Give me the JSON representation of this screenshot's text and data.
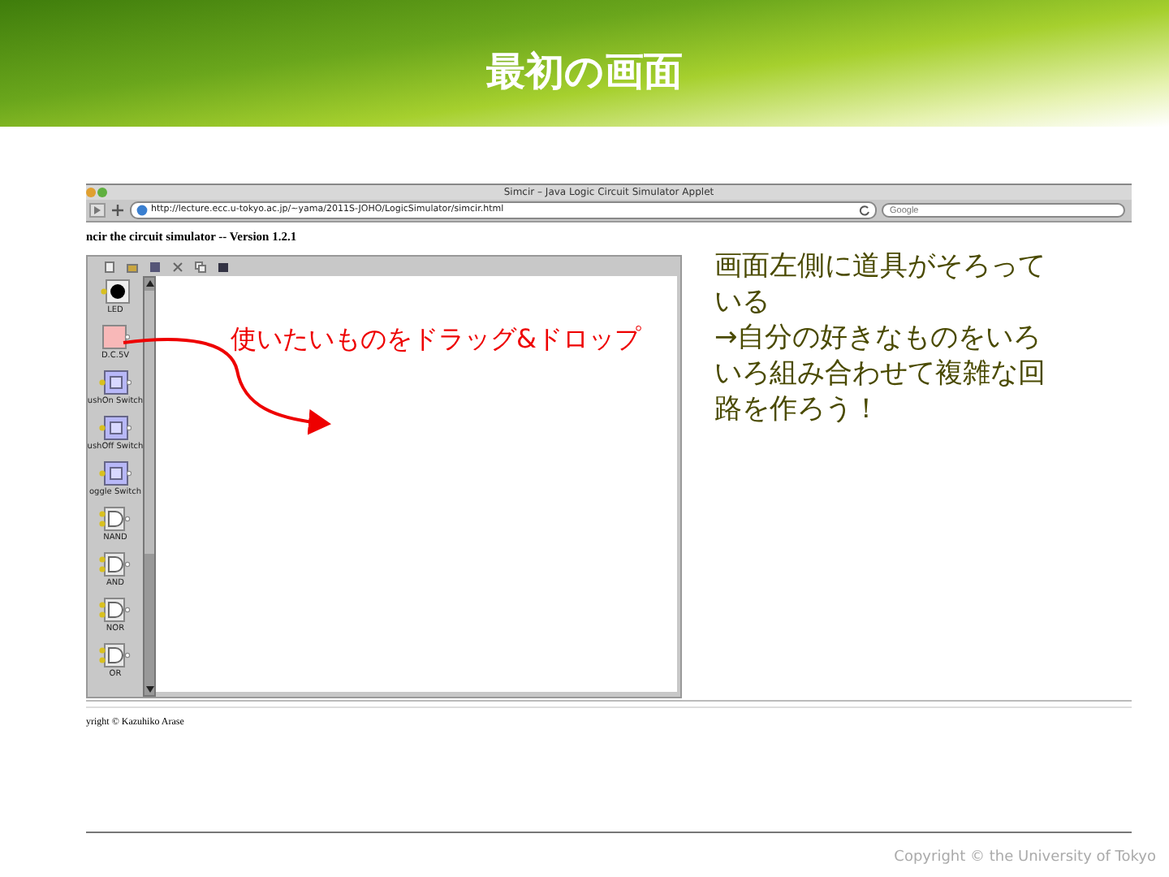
{
  "slide": {
    "title": "最初の画面"
  },
  "browser": {
    "window_title": "Simcir – Java Logic Circuit Simulator Applet",
    "url": "http://lecture.ecc.u-tokyo.ac.jp/~yama/2011S-JOHO/LogicSimulator/simcir.html",
    "search": {
      "placeholder": "Google"
    },
    "page_heading": "ncir the circuit simulator -- Version 1.2.1",
    "palette": [
      {
        "label": "LED",
        "kind": "led"
      },
      {
        "label": "D.C.5V",
        "kind": "dc"
      },
      {
        "label": "ushOn Switch",
        "kind": "switch"
      },
      {
        "label": "ushOff Switch",
        "kind": "switch"
      },
      {
        "label": "oggle Switch",
        "kind": "switch"
      },
      {
        "label": "NAND",
        "kind": "gate"
      },
      {
        "label": "AND",
        "kind": "gate"
      },
      {
        "label": "NOR",
        "kind": "gate"
      },
      {
        "label": "OR",
        "kind": "gate"
      }
    ],
    "page_footer": "yright © Kazuhiko Arase"
  },
  "annotation": {
    "text": "使いたいものをドラッグ&ドロップ"
  },
  "note": {
    "paragraphs": [
      "画面左側に道具がそろっている",
      "→自分の好きなものをいろいろ組み合わせて複雑な回路を作ろう！"
    ]
  },
  "footer": "Copyright © the University of Tokyo"
}
